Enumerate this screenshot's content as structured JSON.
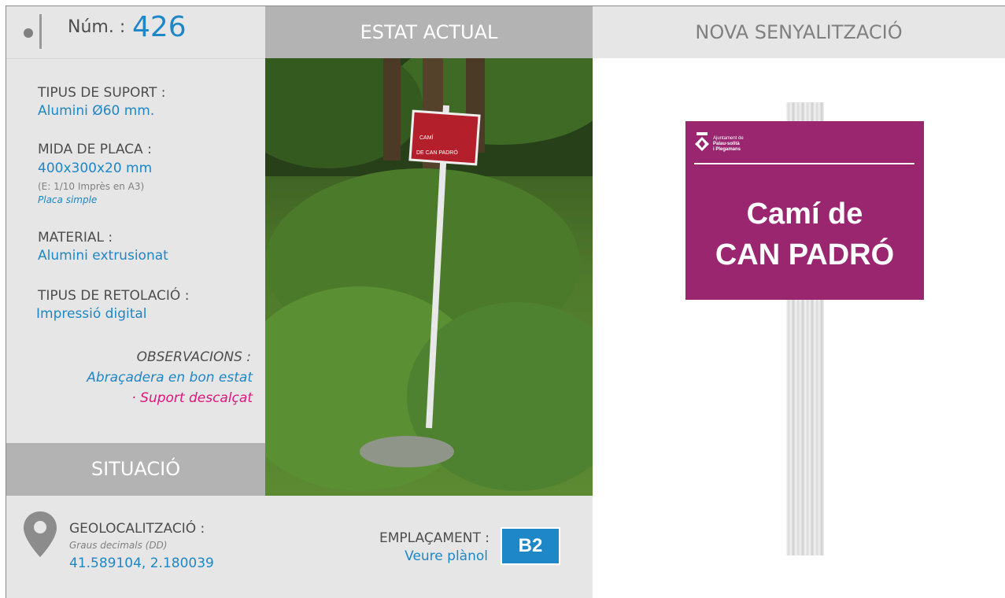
{
  "header": {
    "num_label": "Núm. :",
    "num_value": "426",
    "estat_actual": "ESTAT ACTUAL",
    "nova_senyalitzacio": "NOVA SENYALITZACIÓ"
  },
  "details": {
    "tipus_suport_label": "TIPUS DE SUPORT :",
    "tipus_suport_value": "Alumini Ø60 mm.",
    "mida_placa_label": "MIDA DE PLACA :",
    "mida_placa_value": "400x300x20 mm",
    "mida_placa_note": "(E: 1/10 Imprès en A3)",
    "placa_tipus": "Placa simple",
    "material_label": "MATERIAL :",
    "material_value": "Alumini extrusionat",
    "retolacio_label": "TIPUS DE RETOLACIÓ :",
    "retolacio_value": "Impressió digital",
    "observacions_label": "OBSERVACIONS :",
    "observacio_1": "Abraçadera en bon estat",
    "observacio_2": "· Suport descalçat"
  },
  "situacio": {
    "title": "SITUACIÓ",
    "geo_label": "GEOLOCALITZACIÓ :",
    "geo_sub": "Graus decimals (DD)",
    "geo_value": "41.589104, 2.180039",
    "emplacament_label": "EMPLAÇAMENT :",
    "emplacament_link": "Veure plànol",
    "emplacament_code": "B2"
  },
  "photo": {
    "sign_line1": "CAMÍ",
    "sign_line2": "DE CAN PADRÓ"
  },
  "new_sign": {
    "logo_line1": "Ajuntament de",
    "logo_line2": "Palau-solità",
    "logo_line3": "i Plegamans",
    "text_line1": "Camí de",
    "text_line2": "CAN PADRÓ",
    "color": "#9a266f"
  },
  "colors": {
    "accent_blue": "#1d87c8",
    "alert_magenta": "#e0147c",
    "panel_grey": "#e6e6e6",
    "header_grey": "#b3b3b3"
  }
}
